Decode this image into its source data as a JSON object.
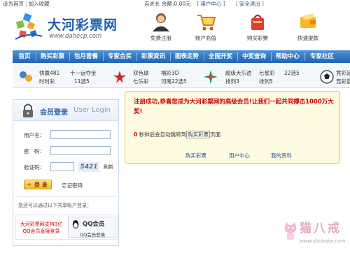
{
  "topbar": {
    "set_home": "设为首页",
    "bookmark": "加入收藏",
    "user": "百夫长",
    "balance_label": "余额:",
    "balance": "0.00元",
    "user_center": "用户中心",
    "logout": "安全退出"
  },
  "logo": {
    "name": "大河彩票网",
    "url": "www.dahecp.com"
  },
  "quick": [
    {
      "label": "免费注册",
      "icon": "person-icon"
    },
    {
      "label": "账户充值",
      "icon": "cart-icon"
    },
    {
      "label": "购买彩票",
      "icon": "bag-icon"
    },
    {
      "label": "快速提款",
      "icon": "wallet-icon"
    }
  ],
  "nav": [
    "首页",
    "购买彩票",
    "包月套餐",
    "专家合买",
    "彩票资讯",
    "图表走势",
    "全国开奖",
    "中奖查询",
    "帮助中心",
    "专家社区"
  ],
  "lotteries": [
    {
      "a": "快赢481",
      "b": "十一运夺金",
      "c": "时时彩",
      "d": "11选5"
    },
    {
      "a": "双色球",
      "b": "福彩3D",
      "c": "七乐彩",
      "d": "河南22选5"
    },
    {
      "a": "超级大乐透",
      "b": "七星彩",
      "c": "22选5",
      "d": "排列3",
      "e": "排列5"
    },
    {
      "a": "竞彩足",
      "b": "竞彩篮"
    }
  ],
  "login": {
    "title": "会员登录",
    "title_en": "User Login",
    "username_label": "用户名：",
    "password_label": "密　码：",
    "captcha_label": "验证码：",
    "captcha_text": "5421",
    "refresh": "刷新",
    "login_button": "登 录",
    "forgot": "忘记密码",
    "share_note": "您还可以通过以下共享账户登录：",
    "qq_promo": "大河彩票网支持3亿QQ会员直接登录",
    "qq_title": "QQ会员",
    "qq_sub": "QQ会员登录"
  },
  "message": {
    "headline": "注册成功,恭喜您成为大河彩票网的高级会员!让我们一起共同搏击1000万大奖!",
    "countdown": "0",
    "redirect_pre": "秒钟后会自动跳转到",
    "redirect_link": "购买彩票",
    "redirect_post": "页面",
    "links": [
      "购买彩票",
      "用户中心",
      "我的资料"
    ]
  },
  "watermark": {
    "text": "猫八戒",
    "url": "www.shubajie.com"
  },
  "colors": {
    "nav": "#1f63b3",
    "logo": "#1f5fb0",
    "alert": "#d00000",
    "panel": "#fffbe0"
  }
}
